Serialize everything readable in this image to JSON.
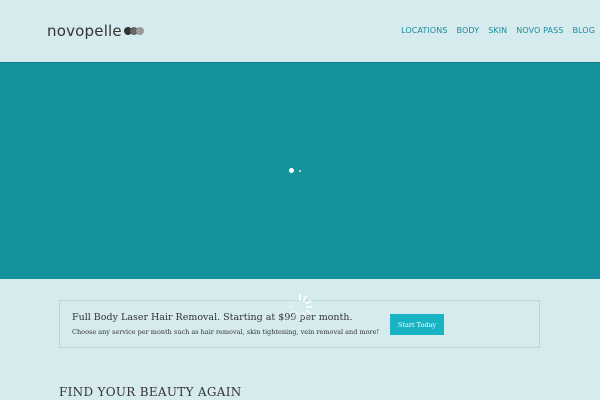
{
  "header": {
    "logo_text": "novopelle",
    "logo_dot_colors": [
      "#333333",
      "#666666",
      "#999999"
    ],
    "nav": [
      "LOCATIONS",
      "BODY",
      "SKIN",
      "NOVO PASS",
      "BLOG"
    ]
  },
  "hero": {
    "background": "#15929b",
    "slide_count": 2,
    "active_slide": 1
  },
  "promo": {
    "title": "Full Body Laser Hair Removal. Starting at $99 per month.",
    "subtitle": "Choose any service per month such as hair removal, skin tightening, vein removal and more!",
    "button_label": "Start Today",
    "button_color": "#19b4c4"
  },
  "section": {
    "title": "FIND YOUR BEAUTY AGAIN"
  },
  "colors": {
    "page_background": "#d6ebed",
    "nav_link": "#1a8a9a"
  }
}
